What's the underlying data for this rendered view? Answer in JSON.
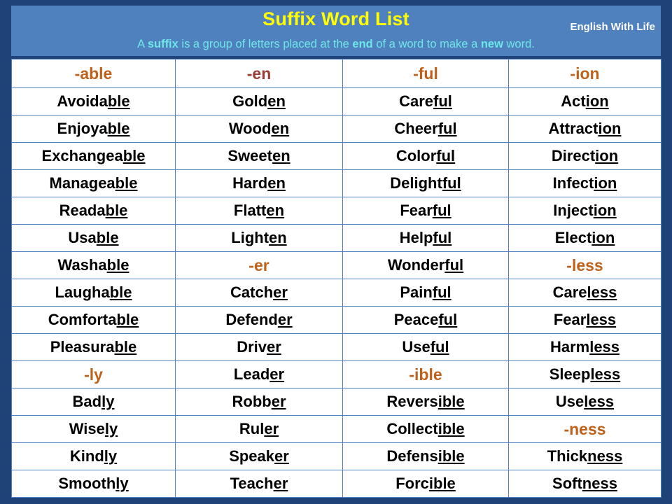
{
  "colors": {
    "frame": "#1F4379",
    "band": "#4E81BD",
    "title": "#FFFF00",
    "subtitle": "#6FE6E6",
    "brand": "#FFFFFF",
    "suffix_brown": "#C0611B",
    "suffix_red": "#9E3B36",
    "grid": "#4E81BD",
    "word": "#000000"
  },
  "header": {
    "title": "Suffix Word List",
    "brand": "English With Life",
    "subtitle_parts": [
      {
        "text": "A ",
        "bold": false
      },
      {
        "text": "suffix",
        "bold": true
      },
      {
        "text": " is a group of letters placed at the ",
        "bold": false
      },
      {
        "text": "end",
        "bold": true
      },
      {
        "text": " of a word to make a ",
        "bold": false
      },
      {
        "text": "new",
        "bold": true
      },
      {
        "text": " word.",
        "bold": false
      }
    ],
    "subtitle_plain": "A suffix is a group of letters placed at the end of a word to make a new word."
  },
  "table": {
    "column_headers": [
      {
        "label": "-able",
        "style": "brown"
      },
      {
        "label": "-en",
        "style": "red"
      },
      {
        "label": "-ful",
        "style": "brown"
      },
      {
        "label": "-ion",
        "style": "brown"
      }
    ],
    "rows": [
      [
        {
          "type": "word",
          "stem": "Avoida",
          "suffix": "ble"
        },
        {
          "type": "word",
          "stem": "Gold",
          "suffix": "en"
        },
        {
          "type": "word",
          "stem": "Care",
          "suffix": "ful"
        },
        {
          "type": "word",
          "stem": "Act",
          "suffix": "ion"
        }
      ],
      [
        {
          "type": "word",
          "stem": "Enjoya",
          "suffix": "ble"
        },
        {
          "type": "word",
          "stem": "Wood",
          "suffix": "en"
        },
        {
          "type": "word",
          "stem": "Cheer",
          "suffix": "ful"
        },
        {
          "type": "word",
          "stem": "Attract",
          "suffix": "ion"
        }
      ],
      [
        {
          "type": "word",
          "stem": "Exchangea",
          "suffix": "ble"
        },
        {
          "type": "word",
          "stem": "Sweet",
          "suffix": "en"
        },
        {
          "type": "word",
          "stem": "Color",
          "suffix": "ful"
        },
        {
          "type": "word",
          "stem": "Direct",
          "suffix": "ion"
        }
      ],
      [
        {
          "type": "word",
          "stem": "Managea",
          "suffix": "ble"
        },
        {
          "type": "word",
          "stem": "Hard",
          "suffix": "en"
        },
        {
          "type": "word",
          "stem": "Delight",
          "suffix": "ful"
        },
        {
          "type": "word",
          "stem": "Infect",
          "suffix": "ion"
        }
      ],
      [
        {
          "type": "word",
          "stem": "Reada",
          "suffix": "ble"
        },
        {
          "type": "word",
          "stem": "Flatt",
          "suffix": "en"
        },
        {
          "type": "word",
          "stem": "Fear",
          "suffix": "ful"
        },
        {
          "type": "word",
          "stem": "Inject",
          "suffix": "ion"
        }
      ],
      [
        {
          "type": "word",
          "stem": "Usa",
          "suffix": "ble"
        },
        {
          "type": "word",
          "stem": "Light",
          "suffix": "en"
        },
        {
          "type": "word",
          "stem": "Help",
          "suffix": "ful"
        },
        {
          "type": "word",
          "stem": "Elect",
          "suffix": "ion"
        }
      ],
      [
        {
          "type": "word",
          "stem": "Washa",
          "suffix": "ble"
        },
        {
          "type": "head",
          "label": "-er",
          "style": "brown"
        },
        {
          "type": "word",
          "stem": "Wonder",
          "suffix": "ful"
        },
        {
          "type": "head",
          "label": "-less",
          "style": "brown"
        }
      ],
      [
        {
          "type": "word",
          "stem": "Laugha",
          "suffix": "ble"
        },
        {
          "type": "word",
          "stem": "Catch",
          "suffix": "er"
        },
        {
          "type": "word",
          "stem": "Pain",
          "suffix": "ful"
        },
        {
          "type": "word",
          "stem": "Care",
          "suffix": "less"
        }
      ],
      [
        {
          "type": "word",
          "stem": "Comforta",
          "suffix": "ble"
        },
        {
          "type": "word",
          "stem": "Defend",
          "suffix": "er"
        },
        {
          "type": "word",
          "stem": "Peace",
          "suffix": "ful"
        },
        {
          "type": "word",
          "stem": "Fear",
          "suffix": "less"
        }
      ],
      [
        {
          "type": "word",
          "stem": "Pleasura",
          "suffix": "ble"
        },
        {
          "type": "word",
          "stem": "Driv",
          "suffix": "er"
        },
        {
          "type": "word",
          "stem": "Use",
          "suffix": "ful"
        },
        {
          "type": "word",
          "stem": "Harm",
          "suffix": "less"
        }
      ],
      [
        {
          "type": "head",
          "label": "-ly",
          "style": "brown"
        },
        {
          "type": "word",
          "stem": "Lead",
          "suffix": "er"
        },
        {
          "type": "head",
          "label": "-ible",
          "style": "brown"
        },
        {
          "type": "word",
          "stem": "Sleep",
          "suffix": "less"
        }
      ],
      [
        {
          "type": "word",
          "stem": "Bad",
          "suffix": "ly"
        },
        {
          "type": "word",
          "stem": "Robb",
          "suffix": "er"
        },
        {
          "type": "word",
          "stem": "Revers",
          "suffix": "ible"
        },
        {
          "type": "word",
          "stem": "Use",
          "suffix": "less"
        }
      ],
      [
        {
          "type": "word",
          "stem": "Wise",
          "suffix": "ly"
        },
        {
          "type": "word",
          "stem": "Rul",
          "suffix": "er"
        },
        {
          "type": "word",
          "stem": "Collect",
          "suffix": "ible"
        },
        {
          "type": "head",
          "label": "-ness",
          "style": "brown"
        }
      ],
      [
        {
          "type": "word",
          "stem": "Kind",
          "suffix": "ly"
        },
        {
          "type": "word",
          "stem": "Speak",
          "suffix": "er"
        },
        {
          "type": "word",
          "stem": "Defens",
          "suffix": "ible"
        },
        {
          "type": "word",
          "stem": "Thick",
          "suffix": "ness"
        }
      ],
      [
        {
          "type": "word",
          "stem": "Smooth",
          "suffix": "ly"
        },
        {
          "type": "word",
          "stem": "Teach",
          "suffix": "er"
        },
        {
          "type": "word",
          "stem": "Forc",
          "suffix": "ible"
        },
        {
          "type": "word",
          "stem": "Soft",
          "suffix": "ness"
        }
      ]
    ]
  }
}
